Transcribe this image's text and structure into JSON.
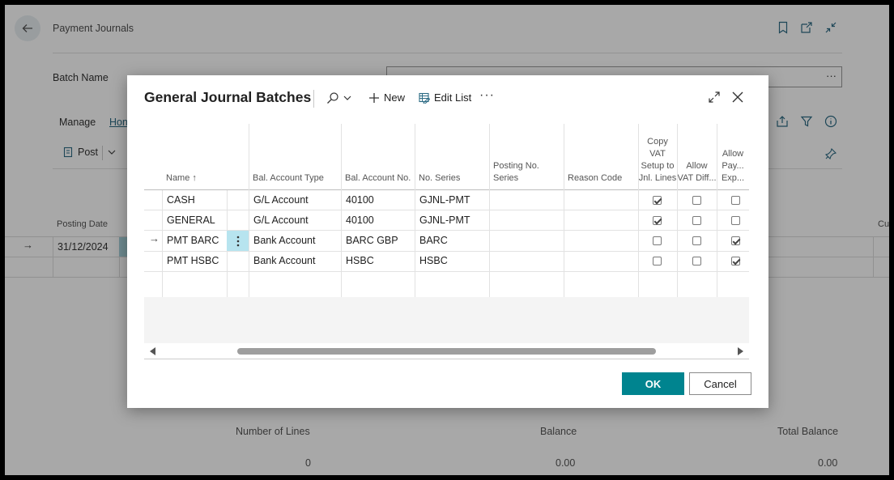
{
  "page": {
    "title": "Payment Journals",
    "batch_name_label": "Batch Name",
    "batch_name_value_dots": "···",
    "manage_label": "Manage",
    "home_label": "Hon",
    "post_label": "Post",
    "posting_date_header": "Posting Date",
    "cu_header": "Cu",
    "row_date": "31/12/2024",
    "footer": {
      "number_of_lines_label": "Number of Lines",
      "number_of_lines_value": "0",
      "balance_label": "Balance",
      "balance_value": "0.00",
      "total_balance_label": "Total Balance",
      "total_balance_value": "0.00"
    }
  },
  "dialog": {
    "title": "General Journal Batches",
    "new_label": "New",
    "edit_list_label": "Edit List",
    "more_label": "···",
    "ok_label": "OK",
    "cancel_label": "Cancel",
    "columns": {
      "name": "Name ↑",
      "bal_account_type": "Bal. Account Type",
      "bal_account_no": "Bal. Account No.",
      "no_series": "No. Series",
      "posting_no_series": "Posting No. Series",
      "reason_code": "Reason Code",
      "copy_vat": "Copy VAT Setup to Jnl. Lines",
      "allow_vat": "Allow VAT Diff...",
      "allow_pay": "Allow Pay... Exp..."
    },
    "rows": [
      {
        "name": "CASH",
        "bal_account_type": "G/L Account",
        "bal_account_no": "40100",
        "no_series": "GJNL-PMT",
        "copy_vat": true,
        "allow_vat": false,
        "allow_pay": false
      },
      {
        "name": "GENERAL",
        "bal_account_type": "G/L Account",
        "bal_account_no": "40100",
        "no_series": "GJNL-PMT",
        "copy_vat": true,
        "allow_vat": false,
        "allow_pay": false
      },
      {
        "name": "PMT BARC",
        "bal_account_type": "Bank Account",
        "bal_account_no": "BARC GBP",
        "no_series": "BARC",
        "copy_vat": false,
        "allow_vat": false,
        "allow_pay": true
      },
      {
        "name": "PMT HSBC",
        "bal_account_type": "Bank Account",
        "bal_account_no": "HSBC",
        "no_series": "HSBC",
        "copy_vat": false,
        "allow_vat": false,
        "allow_pay": true
      }
    ]
  },
  "colors": {
    "accent": "#00848f",
    "selection": "#b7e4ef",
    "link": "#2c6b84"
  }
}
